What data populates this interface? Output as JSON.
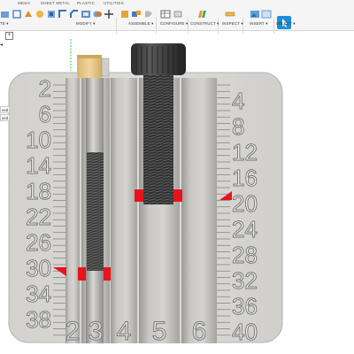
{
  "toolbar": {
    "tabs": [
      "MESH",
      "SHEET METAL",
      "PLASTIC",
      "UTILITIES"
    ],
    "groups": [
      "MODIFY ▾",
      "ASSEMBLE ▾",
      "CONFIGURE ▾",
      "CONSTRUCT ▾",
      "INSPECT ▾",
      "INSERT ▾",
      "SELECT ▾"
    ],
    "left_label": "TE ▾"
  },
  "browser": {
    "toggle_label": "+",
    "collapse_label": "◂",
    "rows": [
      "ved 5",
      "ved 5"
    ]
  },
  "model": {
    "left_scale": [
      "2",
      "6",
      "10",
      "14",
      "18",
      "22",
      "26",
      "30",
      "34",
      "38"
    ],
    "right_scale": [
      "4",
      "8",
      "12",
      "16",
      "20",
      "24",
      "28",
      "32",
      "36",
      "40"
    ],
    "slot_labels": [
      "2",
      "3",
      "4",
      "5",
      "6"
    ],
    "colors": {
      "gauge_body": "#d9d8d5",
      "marker": "#e8141c",
      "bolt": "#3a3a3a",
      "brass_cap": "#e7c98a"
    }
  }
}
